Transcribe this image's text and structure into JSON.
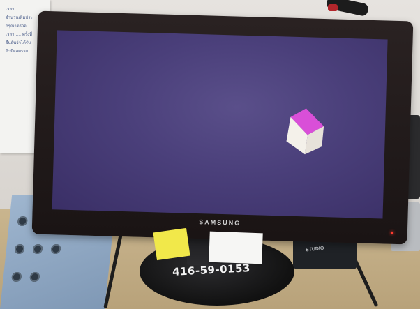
{
  "scene": {
    "monitor_brand": "SAMSUNG",
    "handwritten_label": "416-59-0153",
    "speaker_brand": "STUDIO",
    "paper_lines": [
      "เวลา .......",
      "จำนวนเพิ่มประ",
      "กรุณาตรวจ",
      "",
      "",
      "เวลา .... ครั้งที่",
      "",
      "ยืนยันว่าได้รับ",
      "ถ้ามีผลตรวจ",
      ""
    ]
  },
  "colors": {
    "screen_bg": "#4a3f7a",
    "cube_top": "#d94fd8",
    "cube_face": "#f4f1ea",
    "power_led": "#ff3b2f"
  }
}
